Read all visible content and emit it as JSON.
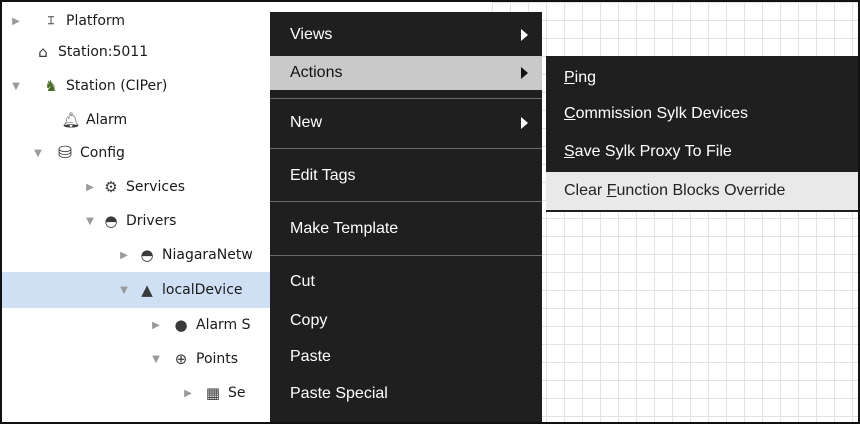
{
  "tree": {
    "items": [
      {
        "label": "Platform",
        "icon": "platform-icon"
      },
      {
        "label": "Station:5011",
        "icon": "station-lock-icon"
      },
      {
        "label": "Station (CIPer)",
        "icon": "station-icon"
      },
      {
        "label": "Alarm",
        "icon": "bell-icon"
      },
      {
        "label": "Config",
        "icon": "database-icon"
      },
      {
        "label": "Services",
        "icon": "gear-icon"
      },
      {
        "label": "Drivers",
        "icon": "drivers-icon"
      },
      {
        "label": "NiagaraNetw",
        "icon": "network-icon"
      },
      {
        "label": "localDevice",
        "icon": "device-icon"
      },
      {
        "label": "Alarm S",
        "icon": "alarm-source-icon"
      },
      {
        "label": "Points",
        "icon": "points-icon"
      },
      {
        "label": "Se",
        "icon": "schedule-icon"
      }
    ]
  },
  "context_menu": {
    "items": {
      "views": "Views",
      "actions": "Actions",
      "new": "New",
      "edit_tags": "Edit Tags",
      "make_template": "Make Template",
      "cut": "Cut",
      "copy": "Copy",
      "paste": "Paste",
      "paste_special": "Paste Special"
    }
  },
  "submenu": {
    "ping": {
      "underlined": "P",
      "rest": "ing"
    },
    "commission": {
      "underlined": "C",
      "rest": "ommission Sylk Devices"
    },
    "save": {
      "underlined": "S",
      "rest": "ave Sylk Proxy To File"
    },
    "clear": {
      "before": "Clear ",
      "underlined": "F",
      "rest": "unction Blocks Override"
    }
  },
  "colors": {
    "menu_bg": "#1f1f1f",
    "menu_hover": "#c9c9c9",
    "submenu_hover": "#e9e9e9",
    "tree_selected": "#cfe0f5"
  }
}
